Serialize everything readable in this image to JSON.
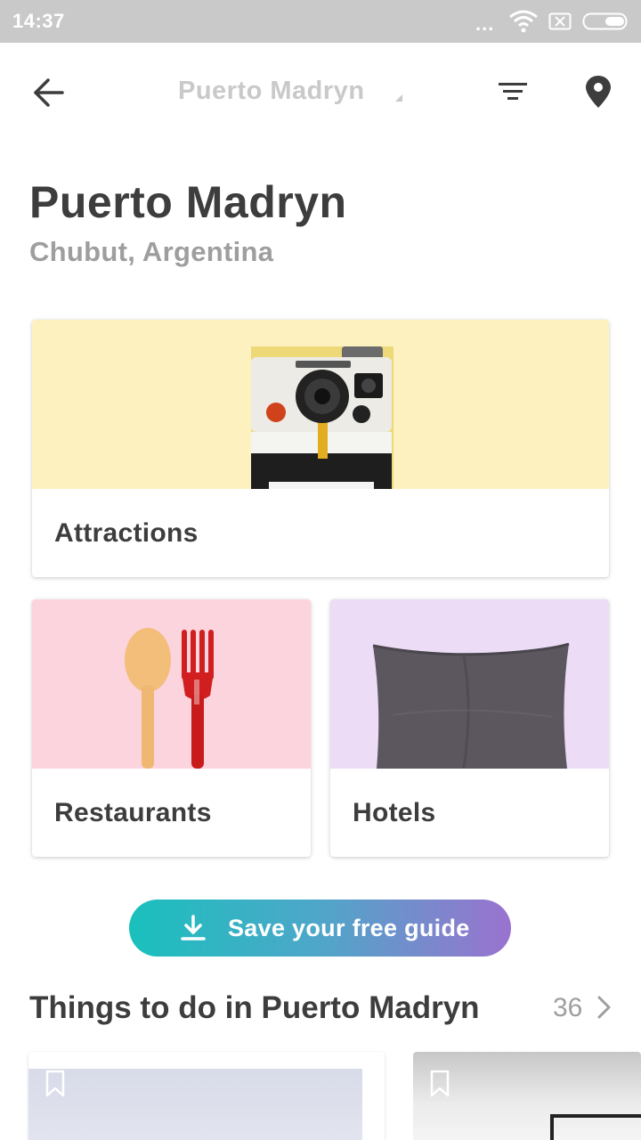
{
  "status_bar": {
    "time": "14:37",
    "dots": "...",
    "icons": [
      "wifi-icon",
      "sim-x-icon",
      "battery-icon"
    ]
  },
  "toolbar": {
    "title": "Puerto Madryn",
    "icons": [
      "back-arrow-icon",
      "dropdown-caret-icon",
      "filter-icon",
      "location-pin-icon"
    ]
  },
  "destination": {
    "name": "Puerto Madryn",
    "region": "Chubut, Argentina"
  },
  "categories": [
    {
      "label": "Attractions",
      "image": "instant-camera",
      "bg": "#fdf2bf"
    },
    {
      "label": "Restaurants",
      "image": "spoon-and-fork",
      "bg": "#fbd4de"
    },
    {
      "label": "Hotels",
      "image": "pillow",
      "bg": "#ecdcf5"
    }
  ],
  "save_button": {
    "label": "Save your free guide",
    "icon": "download-icon",
    "gradient": [
      "#19c0bd",
      "#9a72cf"
    ]
  },
  "things_to_do": {
    "title": "Things to do in Puerto Madryn",
    "count": "36",
    "icon": "chevron-right-icon"
  },
  "colors": {
    "text_dark": "#3d3d3d",
    "text_muted": "#9e9e9e",
    "toolbar_title": "#c9c9c9",
    "status_bar": "#c9c9c9"
  }
}
